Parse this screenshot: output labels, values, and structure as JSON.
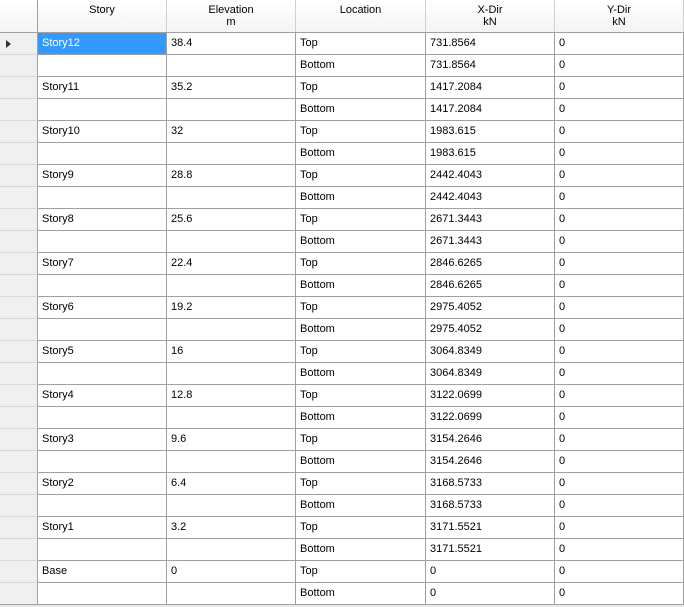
{
  "columns": [
    {
      "label": "Story",
      "unit": ""
    },
    {
      "label": "Elevation",
      "unit": "m"
    },
    {
      "label": "Location",
      "unit": ""
    },
    {
      "label": "X-Dir",
      "unit": "kN"
    },
    {
      "label": "Y-Dir",
      "unit": "kN"
    }
  ],
  "rows": [
    [
      "Story12",
      "38.4",
      "Top",
      "731.8564",
      "0"
    ],
    [
      "",
      "",
      "Bottom",
      "731.8564",
      "0"
    ],
    [
      "Story11",
      "35.2",
      "Top",
      "1417.2084",
      "0"
    ],
    [
      "",
      "",
      "Bottom",
      "1417.2084",
      "0"
    ],
    [
      "Story10",
      "32",
      "Top",
      "1983.615",
      "0"
    ],
    [
      "",
      "",
      "Bottom",
      "1983.615",
      "0"
    ],
    [
      "Story9",
      "28.8",
      "Top",
      "2442.4043",
      "0"
    ],
    [
      "",
      "",
      "Bottom",
      "2442.4043",
      "0"
    ],
    [
      "Story8",
      "25.6",
      "Top",
      "2671.3443",
      "0"
    ],
    [
      "",
      "",
      "Bottom",
      "2671.3443",
      "0"
    ],
    [
      "Story7",
      "22.4",
      "Top",
      "2846.6265",
      "0"
    ],
    [
      "",
      "",
      "Bottom",
      "2846.6265",
      "0"
    ],
    [
      "Story6",
      "19.2",
      "Top",
      "2975.4052",
      "0"
    ],
    [
      "",
      "",
      "Bottom",
      "2975.4052",
      "0"
    ],
    [
      "Story5",
      "16",
      "Top",
      "3064.8349",
      "0"
    ],
    [
      "",
      "",
      "Bottom",
      "3064.8349",
      "0"
    ],
    [
      "Story4",
      "12.8",
      "Top",
      "3122.0699",
      "0"
    ],
    [
      "",
      "",
      "Bottom",
      "3122.0699",
      "0"
    ],
    [
      "Story3",
      "9.6",
      "Top",
      "3154.2646",
      "0"
    ],
    [
      "",
      "",
      "Bottom",
      "3154.2646",
      "0"
    ],
    [
      "Story2",
      "6.4",
      "Top",
      "3168.5733",
      "0"
    ],
    [
      "",
      "",
      "Bottom",
      "3168.5733",
      "0"
    ],
    [
      "Story1",
      "3.2",
      "Top",
      "3171.5521",
      "0"
    ],
    [
      "",
      "",
      "Bottom",
      "3171.5521",
      "0"
    ],
    [
      "Base",
      "0",
      "Top",
      "0",
      "0"
    ],
    [
      "",
      "",
      "Bottom",
      "0",
      "0"
    ]
  ],
  "selection": {
    "row": 0,
    "col": 0
  },
  "current_row_indicator": "row-pointer-icon",
  "colors": {
    "selection": "#3399ff",
    "grid_line": "#a0a0a0",
    "row_header": "#f0f0f0"
  }
}
